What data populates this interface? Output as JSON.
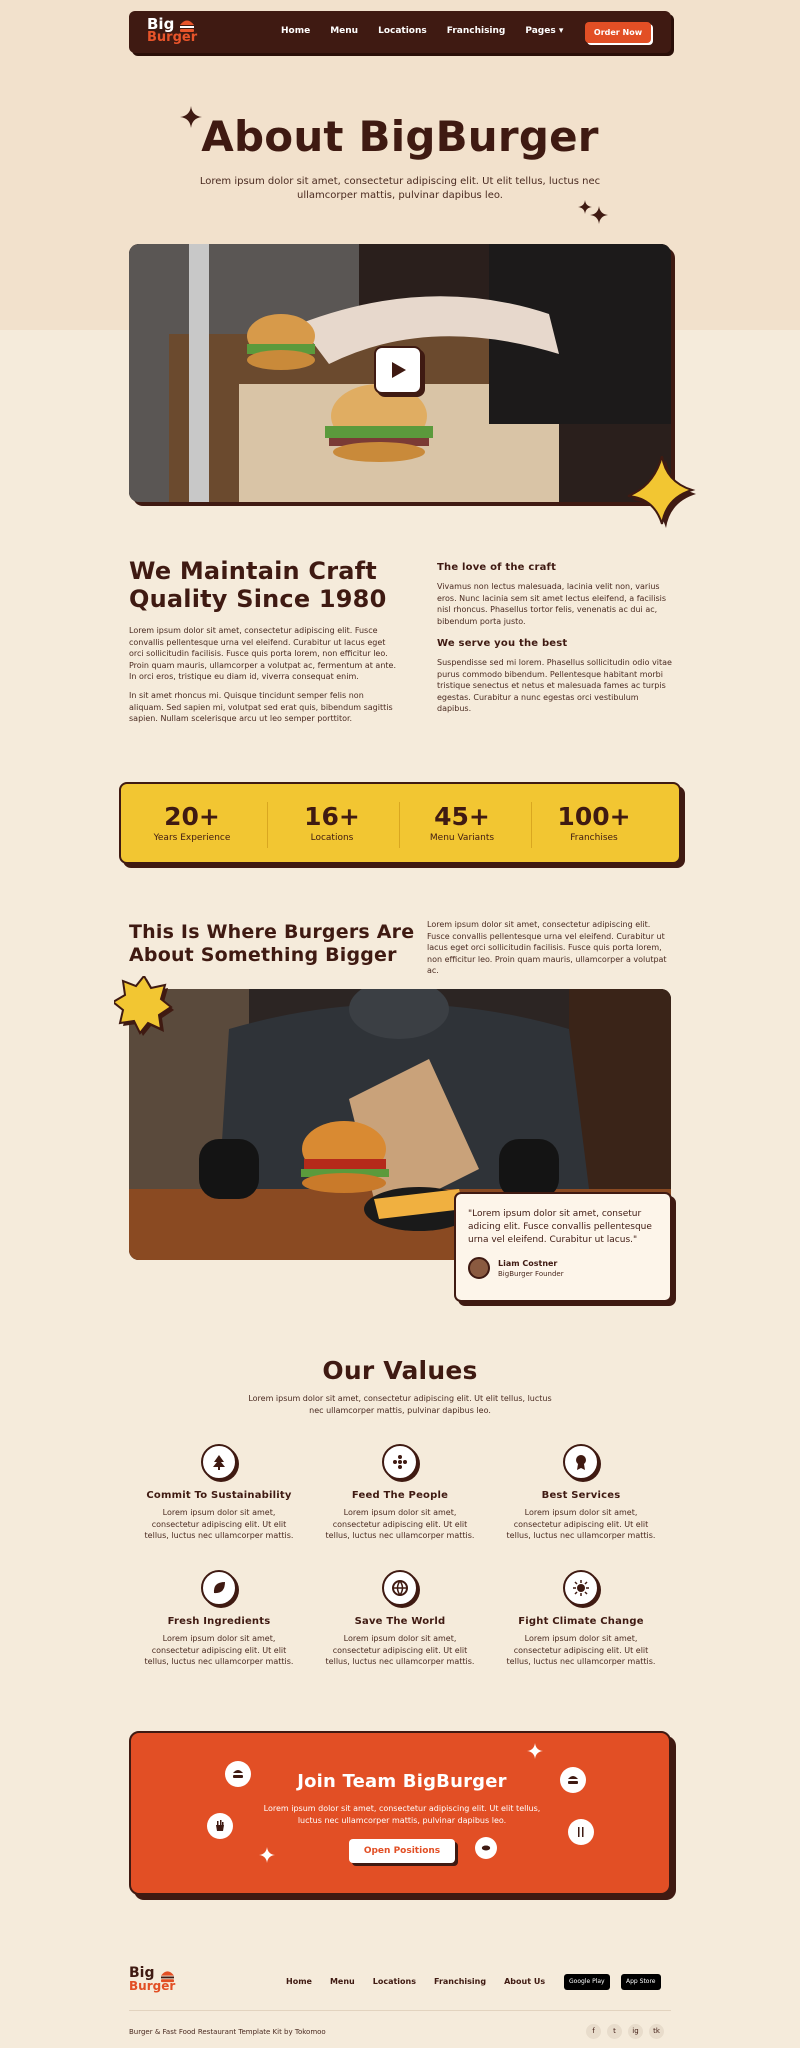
{
  "nav": {
    "logo_line1": "Big",
    "logo_line2": "Burger",
    "links": [
      "Home",
      "Menu",
      "Locations",
      "Franchising",
      "Pages ▾"
    ],
    "cta": "Order Now"
  },
  "hero": {
    "title": "About BigBurger",
    "subtitle_line1": "Lorem ipsum dolor sit amet, consectetur adipiscing elit. Ut elit tellus, luctus nec",
    "subtitle_line2": "ullamcorper mattis, pulvinar dapibus leo."
  },
  "craft": {
    "title_line1": "We Maintain Craft",
    "title_line2": "Quality Since 1980",
    "para1": "Lorem ipsum dolor sit amet, consectetur adipiscing elit. Fusce convallis pellentesque urna vel eleifend. Curabitur ut lacus eget orci sollicitudin facilisis. Fusce quis porta lorem, non efficitur leo. Proin quam mauris, ullamcorper a volutpat ac, fermentum at ante. In orci eros, tristique eu diam id, viverra consequat enim.",
    "para2": "In sit amet rhoncus mi. Quisque tincidunt semper felis non aliquam. Sed sapien mi, volutpat sed erat quis, bibendum sagittis sapien. Nullam scelerisque arcu ut leo semper porttitor.",
    "love_title": "The love of the craft",
    "love_text": "Vivamus non lectus malesuada, lacinia velit non, varius eros. Nunc lacinia sem sit amet lectus eleifend, a facilisis nisl rhoncus. Phasellus tortor felis, venenatis ac dui ac, bibendum porta justo.",
    "serve_title": "We serve you the best",
    "serve_text": "Suspendisse sed mi lorem. Phasellus sollicitudin odio vitae purus commodo bibendum. Pellentesque habitant morbi tristique senectus et netus et malesuada fames ac turpis egestas. Curabitur a nunc egestas orci vestibulum dapibus."
  },
  "stats": [
    {
      "number": "20+",
      "label": "Years Experience"
    },
    {
      "number": "16+",
      "label": "Locations"
    },
    {
      "number": "45+",
      "label": "Menu Variants"
    },
    {
      "number": "100+",
      "label": "Franchises"
    }
  ],
  "bigger": {
    "title_line1": "This Is Where Burgers Are",
    "title_line2": "About Something Bigger",
    "text": "Lorem ipsum dolor sit amet, consectetur adipiscing elit. Fusce convallis pellentesque urna vel eleifend. Curabitur ut lacus eget orci sollicitudin facilisis. Fusce quis porta lorem, non efficitur leo. Proin quam mauris, ullamcorper a volutpat ac."
  },
  "quote": {
    "text": "\"Lorem ipsum dolor sit amet, consetur adicing elit. Fusce convallis pellentesque urna vel eleifend. Curabitur ut lacus.\"",
    "name": "Liam Costner",
    "role": "BigBurger Founder"
  },
  "values": {
    "title": "Our Values",
    "subtitle_line1": "Lorem ipsum dolor sit amet, consectetur adipiscing elit. Ut elit tellus, luctus",
    "subtitle_line2": "nec ullamcorper mattis, pulvinar dapibus leo.",
    "item_text": "Lorem ipsum dolor sit amet, consectetur adipiscing elit. Ut elit tellus, luctus nec ullamcorper mattis.",
    "items": [
      {
        "title": "Commit To Sustainability",
        "icon": "tree-icon"
      },
      {
        "title": "Feed The People",
        "icon": "dots-icon"
      },
      {
        "title": "Best Services",
        "icon": "award-icon"
      },
      {
        "title": "Fresh Ingredients",
        "icon": "leaf-icon"
      },
      {
        "title": "Save The World",
        "icon": "globe-icon"
      },
      {
        "title": "Fight Climate Change",
        "icon": "sun-icon"
      }
    ]
  },
  "cta": {
    "title": "Join Team BigBurger",
    "text_line1": "Lorem ipsum dolor sit amet, consectetur adipiscing elit. Ut elit tellus,",
    "text_line2": "luctus nec ullamcorper mattis, pulvinar dapibus leo.",
    "button": "Open Positions"
  },
  "footer": {
    "links": [
      "Home",
      "Menu",
      "Locations",
      "Franchising",
      "About Us"
    ],
    "google_play": "Google Play",
    "app_store": "App Store",
    "credit": "Burger & Fast Food Restaurant Template Kit by Tokomoo",
    "social": [
      "f",
      "t",
      "ig",
      "tk"
    ]
  },
  "colors": {
    "brown": "#3f1a12",
    "orange": "#e24f25",
    "yellow": "#f2c632",
    "cream": "#f5ebdb"
  }
}
